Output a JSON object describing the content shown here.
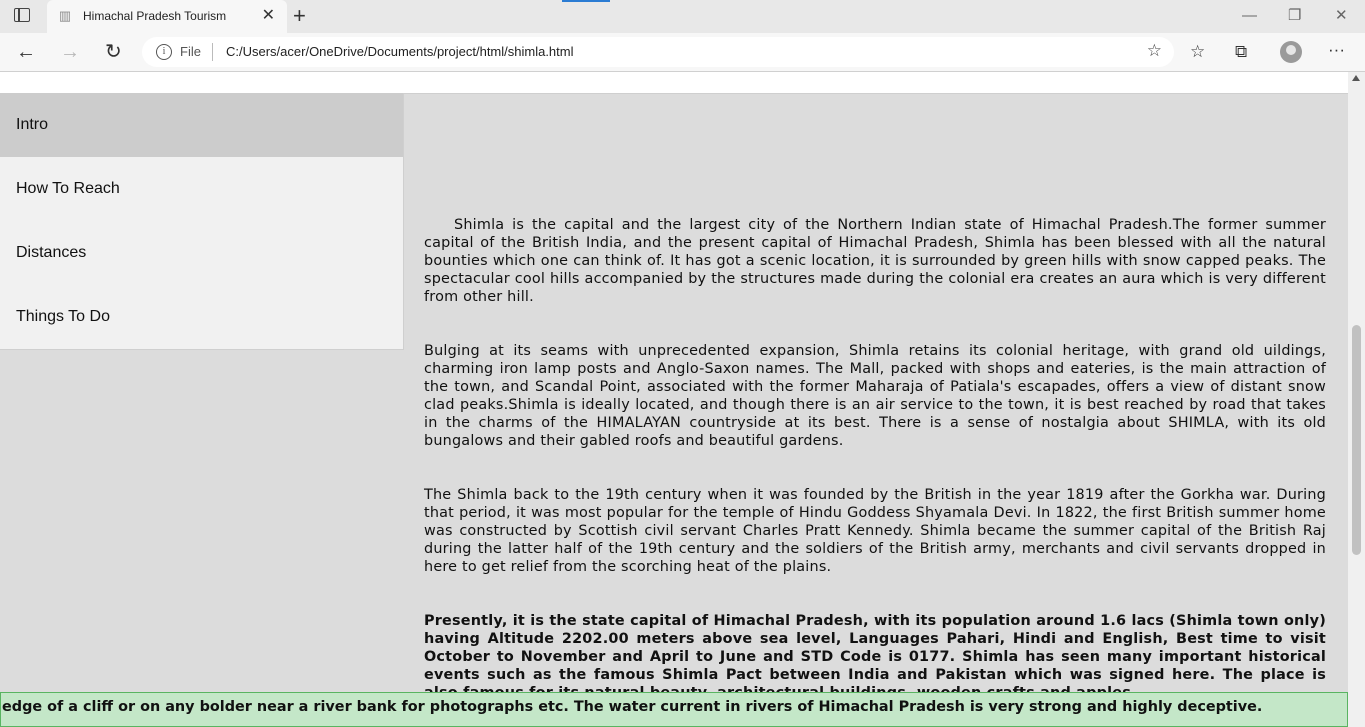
{
  "browser": {
    "tab_title": "Himachal Pradesh Tourism",
    "tab_close": "✕",
    "new_tab": "+",
    "address_scheme": "File",
    "url": "C:/Users/acer/OneDrive/Documents/project/html/shimla.html",
    "back": "←",
    "forward": "→",
    "reload": "↻",
    "minimize": "—",
    "restore": "❐",
    "close": "✕",
    "menu": "···"
  },
  "sidebar": {
    "items": [
      {
        "label": "Intro"
      },
      {
        "label": "How To Reach"
      },
      {
        "label": "Distances"
      },
      {
        "label": "Things To Do"
      }
    ]
  },
  "content": {
    "paragraphs": [
      "Shimla is the capital and the largest city of the Northern Indian state of Himachal Pradesh.The former summer capital of the British India, and the present capital of Himachal Pradesh, Shimla has been blessed with all the natural bounties which one can think of. It has got a scenic location, it is surrounded by green hills with snow capped peaks. The spectacular cool hills accompanied by the structures made during the colonial era creates an aura which is very different from other hill.",
      "Bulging at its seams with unprecedented expansion, Shimla retains its colonial heritage, with grand old uildings, charming iron lamp posts and Anglo-Saxon names. The Mall, packed with shops and eateries, is the main attraction of the town, and Scandal Point, associated with the former Maharaja of Patiala's escapades, offers a view of distant snow clad peaks.Shimla is ideally located, and though there is an air service to the town, it is best reached by road that takes in the charms of the HIMALAYAN countryside at its best. There is a sense of nostalgia about SHIMLA, with its old bungalows and their gabled roofs and beautiful gardens.",
      "The Shimla back to the 19th century when it was founded by the British in the year 1819 after the Gorkha war. During that period, it was most popular for the temple of Hindu Goddess Shyamala Devi. In 1822, the first British summer home was constructed by Scottish civil servant Charles Pratt Kennedy. Shimla became the summer capital of the British Raj during the latter half of the 19th century and the soldiers of the British army, merchants and civil servants dropped in here to get relief from the scorching heat of the plains.",
      "Presently, it is the state capital of Himachal Pradesh, with its population around 1.6 lacs (Shimla town only) having Altitude 2202.00 meters above sea level, Languages Pahari, Hindi and English, Best time to visit October to November and April to June and STD Code is 0177. Shimla has seen many important historical events such as the famous Shimla Pact between India and Pakistan which was signed here. The place is also famous for its natural beauty, architectural buildings, wooden crafts and apples."
    ]
  },
  "marquee": {
    "text": "he edge of a cliff or on any bolder near a river bank for photographs etc. The water current in rivers of Himachal Pradesh is very strong and highly deceptive."
  }
}
